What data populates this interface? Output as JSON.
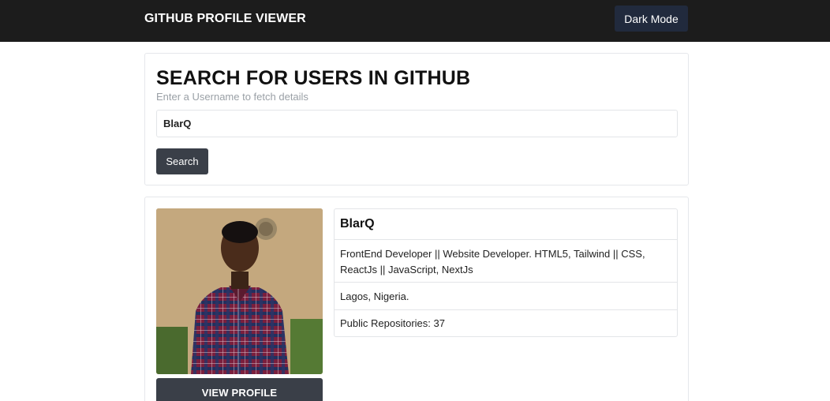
{
  "navbar": {
    "brand": "GITHUB PROFILE VIEWER",
    "dark_mode_label": "Dark Mode"
  },
  "search": {
    "title": "SEARCH FOR USERS IN GITHUB",
    "subtitle": "Enter a Username to fetch details",
    "input_value": "BlarQ",
    "button_label": "Search"
  },
  "profile": {
    "username": "BlarQ",
    "bio": "FrontEnd Developer || Website Developer. HTML5, Tailwind || CSS, ReactJs || JavaScript, NextJs",
    "location": "Lagos, Nigeria.",
    "public_repos": "Public Repositories: 37",
    "view_profile_label": "VIEW PROFILE"
  },
  "colors": {
    "navbar_bg": "#1c1c1c",
    "dark_button_bg": "#212a3d",
    "button_bg": "#3a3f48"
  }
}
